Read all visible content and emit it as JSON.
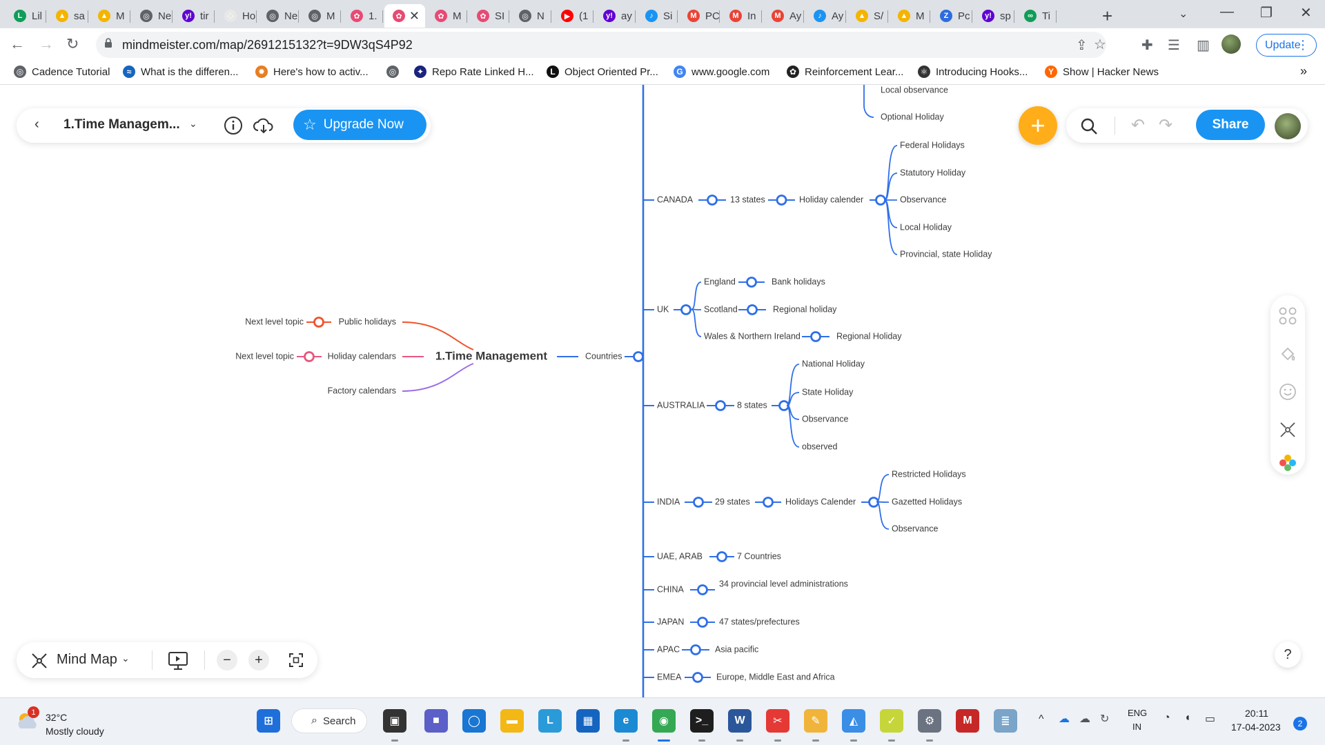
{
  "browser": {
    "tabs": [
      {
        "label": "Lil",
        "color": "#0f9d58",
        "glyph": "L"
      },
      {
        "label": "sa",
        "color": "#f4b400",
        "glyph": "▲"
      },
      {
        "label": "M",
        "color": "#f4b400",
        "glyph": "▲"
      },
      {
        "label": "Ne",
        "color": "#5f6368",
        "glyph": "◎"
      },
      {
        "label": "tir",
        "color": "#6001d2",
        "glyph": "y!"
      },
      {
        "label": "Ho",
        "color": "#e8e8e8",
        "glyph": "⁘"
      },
      {
        "label": "Ne",
        "color": "#5f6368",
        "glyph": "◎"
      },
      {
        "label": "M",
        "color": "#5f6368",
        "glyph": "◎"
      },
      {
        "label": "1.",
        "color": "#e84a73",
        "glyph": "✿"
      },
      {
        "label": "",
        "color": "#e84a73",
        "glyph": "✿",
        "active": true
      },
      {
        "label": "M",
        "color": "#e84a73",
        "glyph": "✿"
      },
      {
        "label": "SI",
        "color": "#e84a73",
        "glyph": "✿"
      },
      {
        "label": "N",
        "color": "#5f6368",
        "glyph": "◎"
      },
      {
        "label": "(1",
        "color": "#ff0000",
        "glyph": "▶"
      },
      {
        "label": "ay",
        "color": "#6001d2",
        "glyph": "y!"
      },
      {
        "label": "Si",
        "color": "#1a94f2",
        "glyph": "♪"
      },
      {
        "label": "PC",
        "color": "#ea4335",
        "glyph": "M"
      },
      {
        "label": "In",
        "color": "#ea4335",
        "glyph": "M"
      },
      {
        "label": "Ay",
        "color": "#ea4335",
        "glyph": "M"
      },
      {
        "label": "Ay",
        "color": "#1a94f2",
        "glyph": "♪"
      },
      {
        "label": "S/",
        "color": "#f4b400",
        "glyph": "▲"
      },
      {
        "label": "M",
        "color": "#f4b400",
        "glyph": "▲"
      },
      {
        "label": "Pc",
        "color": "#2d6cdf",
        "glyph": "Z"
      },
      {
        "label": "sp",
        "color": "#6001d2",
        "glyph": "y!"
      },
      {
        "label": "Ti",
        "color": "#0f9d58",
        "glyph": "∞"
      }
    ],
    "url": "mindmeister.com/map/2691215132?t=9DW3qS4P92",
    "update_label": "Update",
    "bookmarks": [
      {
        "label": "Cadence Tutorial",
        "color": "#5f6368",
        "glyph": "◎"
      },
      {
        "label": "What is the differen...",
        "color": "#1565c0",
        "glyph": "≈"
      },
      {
        "label": "Here's how to activ...",
        "color": "#e67e22",
        "glyph": "✹"
      },
      {
        "label": "",
        "color": "#5f6368",
        "glyph": "◎"
      },
      {
        "label": "Repo Rate Linked H...",
        "color": "#1a237e",
        "glyph": "✦"
      },
      {
        "label": "Object Oriented Pr...",
        "color": "#111111",
        "glyph": "L"
      },
      {
        "label": "www.google.com",
        "color": "#4285f4",
        "glyph": "G"
      },
      {
        "label": "Reinforcement Lear...",
        "color": "#222222",
        "glyph": "✿"
      },
      {
        "label": "Introducing Hooks...",
        "color": "#333333",
        "glyph": "⚛"
      },
      {
        "label": "Show | Hacker News",
        "color": "#ff6600",
        "glyph": "Y"
      }
    ]
  },
  "app": {
    "map_title": "1.Time Managem...",
    "upgrade_label": "Upgrade Now",
    "share_label": "Share",
    "view_mode": "Mind Map",
    "help_glyph": "?"
  },
  "mindmap": {
    "root": "1.Time Management",
    "left_branches": [
      {
        "label": "Public holidays",
        "child": "Next level topic",
        "color": "#f0522d"
      },
      {
        "label": "Holiday calendars",
        "child": "Next level topic",
        "color": "#e8567e"
      },
      {
        "label": "Factory calendars",
        "child": "",
        "color": "#9b6ee8"
      }
    ],
    "right_branch": "Countries",
    "branch_color": "#2f6fe8",
    "top_partial": [
      "Local observance",
      "Optional Holiday"
    ],
    "countries": [
      {
        "name": "CANADA",
        "chain": [
          "13 states",
          "Holiday calender"
        ],
        "leaves": [
          "Federal Holidays",
          "Statutory Holiday",
          "Observance",
          "Local Holiday",
          "Provincial, state Holiday"
        ]
      },
      {
        "name": "UK",
        "sub": [
          {
            "label": "England",
            "leaf": "Bank holidays"
          },
          {
            "label": "Scotland",
            "leaf": "Regional holiday"
          },
          {
            "label": "Wales & Northern Ireland",
            "leaf": "Regional Holiday"
          }
        ]
      },
      {
        "name": "AUSTRALIA",
        "chain": [
          "8 states"
        ],
        "leaves": [
          "National Holiday",
          "State Holiday",
          "Observance",
          "observed"
        ]
      },
      {
        "name": "INDIA",
        "chain": [
          "29 states",
          "Holidays Calender"
        ],
        "leaves": [
          "Restricted Holidays",
          "Gazetted Holidays",
          "Observance"
        ]
      },
      {
        "name": "UAE, ARAB",
        "chain": [
          "7 Countries"
        ]
      },
      {
        "name": "CHINA",
        "chain": [
          "34 provincial level administrations"
        ]
      },
      {
        "name": "JAPAN",
        "chain": [
          "47 states/prefectures"
        ]
      },
      {
        "name": "APAC",
        "chain": [
          "Asia pacific"
        ]
      },
      {
        "name": "EMEA",
        "chain": [
          "Europe, Middle East and Africa"
        ]
      }
    ]
  },
  "taskbar": {
    "weather_temp": "32°C",
    "weather_desc": "Mostly cloudy",
    "weather_badge": "1",
    "search_label": "Search",
    "lang_top": "ENG",
    "lang_bottom": "IN",
    "time": "20:11",
    "date": "17-04-2023",
    "notif_count": "2",
    "apps": [
      {
        "name": "windows-start",
        "color": "#1e6fd9",
        "glyph": "⊞"
      },
      {
        "name": "task-view",
        "color": "#333333",
        "glyph": "▣"
      },
      {
        "name": "teams",
        "color": "#5b5fc7",
        "glyph": "■"
      },
      {
        "name": "cortana",
        "color": "#1976d2",
        "glyph": "◯"
      },
      {
        "name": "file-explorer",
        "color": "#f3b816",
        "glyph": "▬"
      },
      {
        "name": "l-app",
        "color": "#2a9bd8",
        "glyph": "L"
      },
      {
        "name": "store",
        "color": "#1565c0",
        "glyph": "▦"
      },
      {
        "name": "edge",
        "color": "#1b8ad3",
        "glyph": "e"
      },
      {
        "name": "chrome",
        "color": "#34a853",
        "glyph": "◉"
      },
      {
        "name": "terminal",
        "color": "#1e1e1e",
        "glyph": ">_"
      },
      {
        "name": "word",
        "color": "#2b579a",
        "glyph": "W"
      },
      {
        "name": "snipping-tool",
        "color": "#e53935",
        "glyph": "✂"
      },
      {
        "name": "pen-app",
        "color": "#f1b43a",
        "glyph": "✎"
      },
      {
        "name": "photos",
        "color": "#3a8ee6",
        "glyph": "◭"
      },
      {
        "name": "tasks",
        "color": "#c6d63a",
        "glyph": "✓"
      },
      {
        "name": "settings",
        "color": "#6b7280",
        "glyph": "⚙"
      },
      {
        "name": "mcafee",
        "color": "#c62828",
        "glyph": "M"
      },
      {
        "name": "notepad-app",
        "color": "#7aa4c8",
        "glyph": "≣"
      }
    ]
  }
}
